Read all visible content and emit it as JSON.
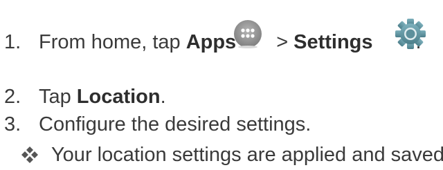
{
  "steps": [
    {
      "number": "1.",
      "text_before": "From home, tap",
      "bold1": "Apps",
      "separator": ">",
      "bold2": "Settings",
      "text_after": "."
    },
    {
      "number": "2.",
      "text_before": "Tap",
      "bold": "Location",
      "text_after": "."
    },
    {
      "number": "3.",
      "text": "Configure the desired settings."
    }
  ],
  "result": {
    "icon": "result-diamond-icon",
    "text": "Your location settings are applied and saved."
  },
  "icons": {
    "apps": "apps-icon",
    "settings": "settings-icon"
  },
  "colors": {
    "text": "#3a3a3a",
    "apps_icon_gray": "#9a9a9a",
    "settings_icon_teal": "#5a8d99",
    "bullet": "#555555"
  }
}
